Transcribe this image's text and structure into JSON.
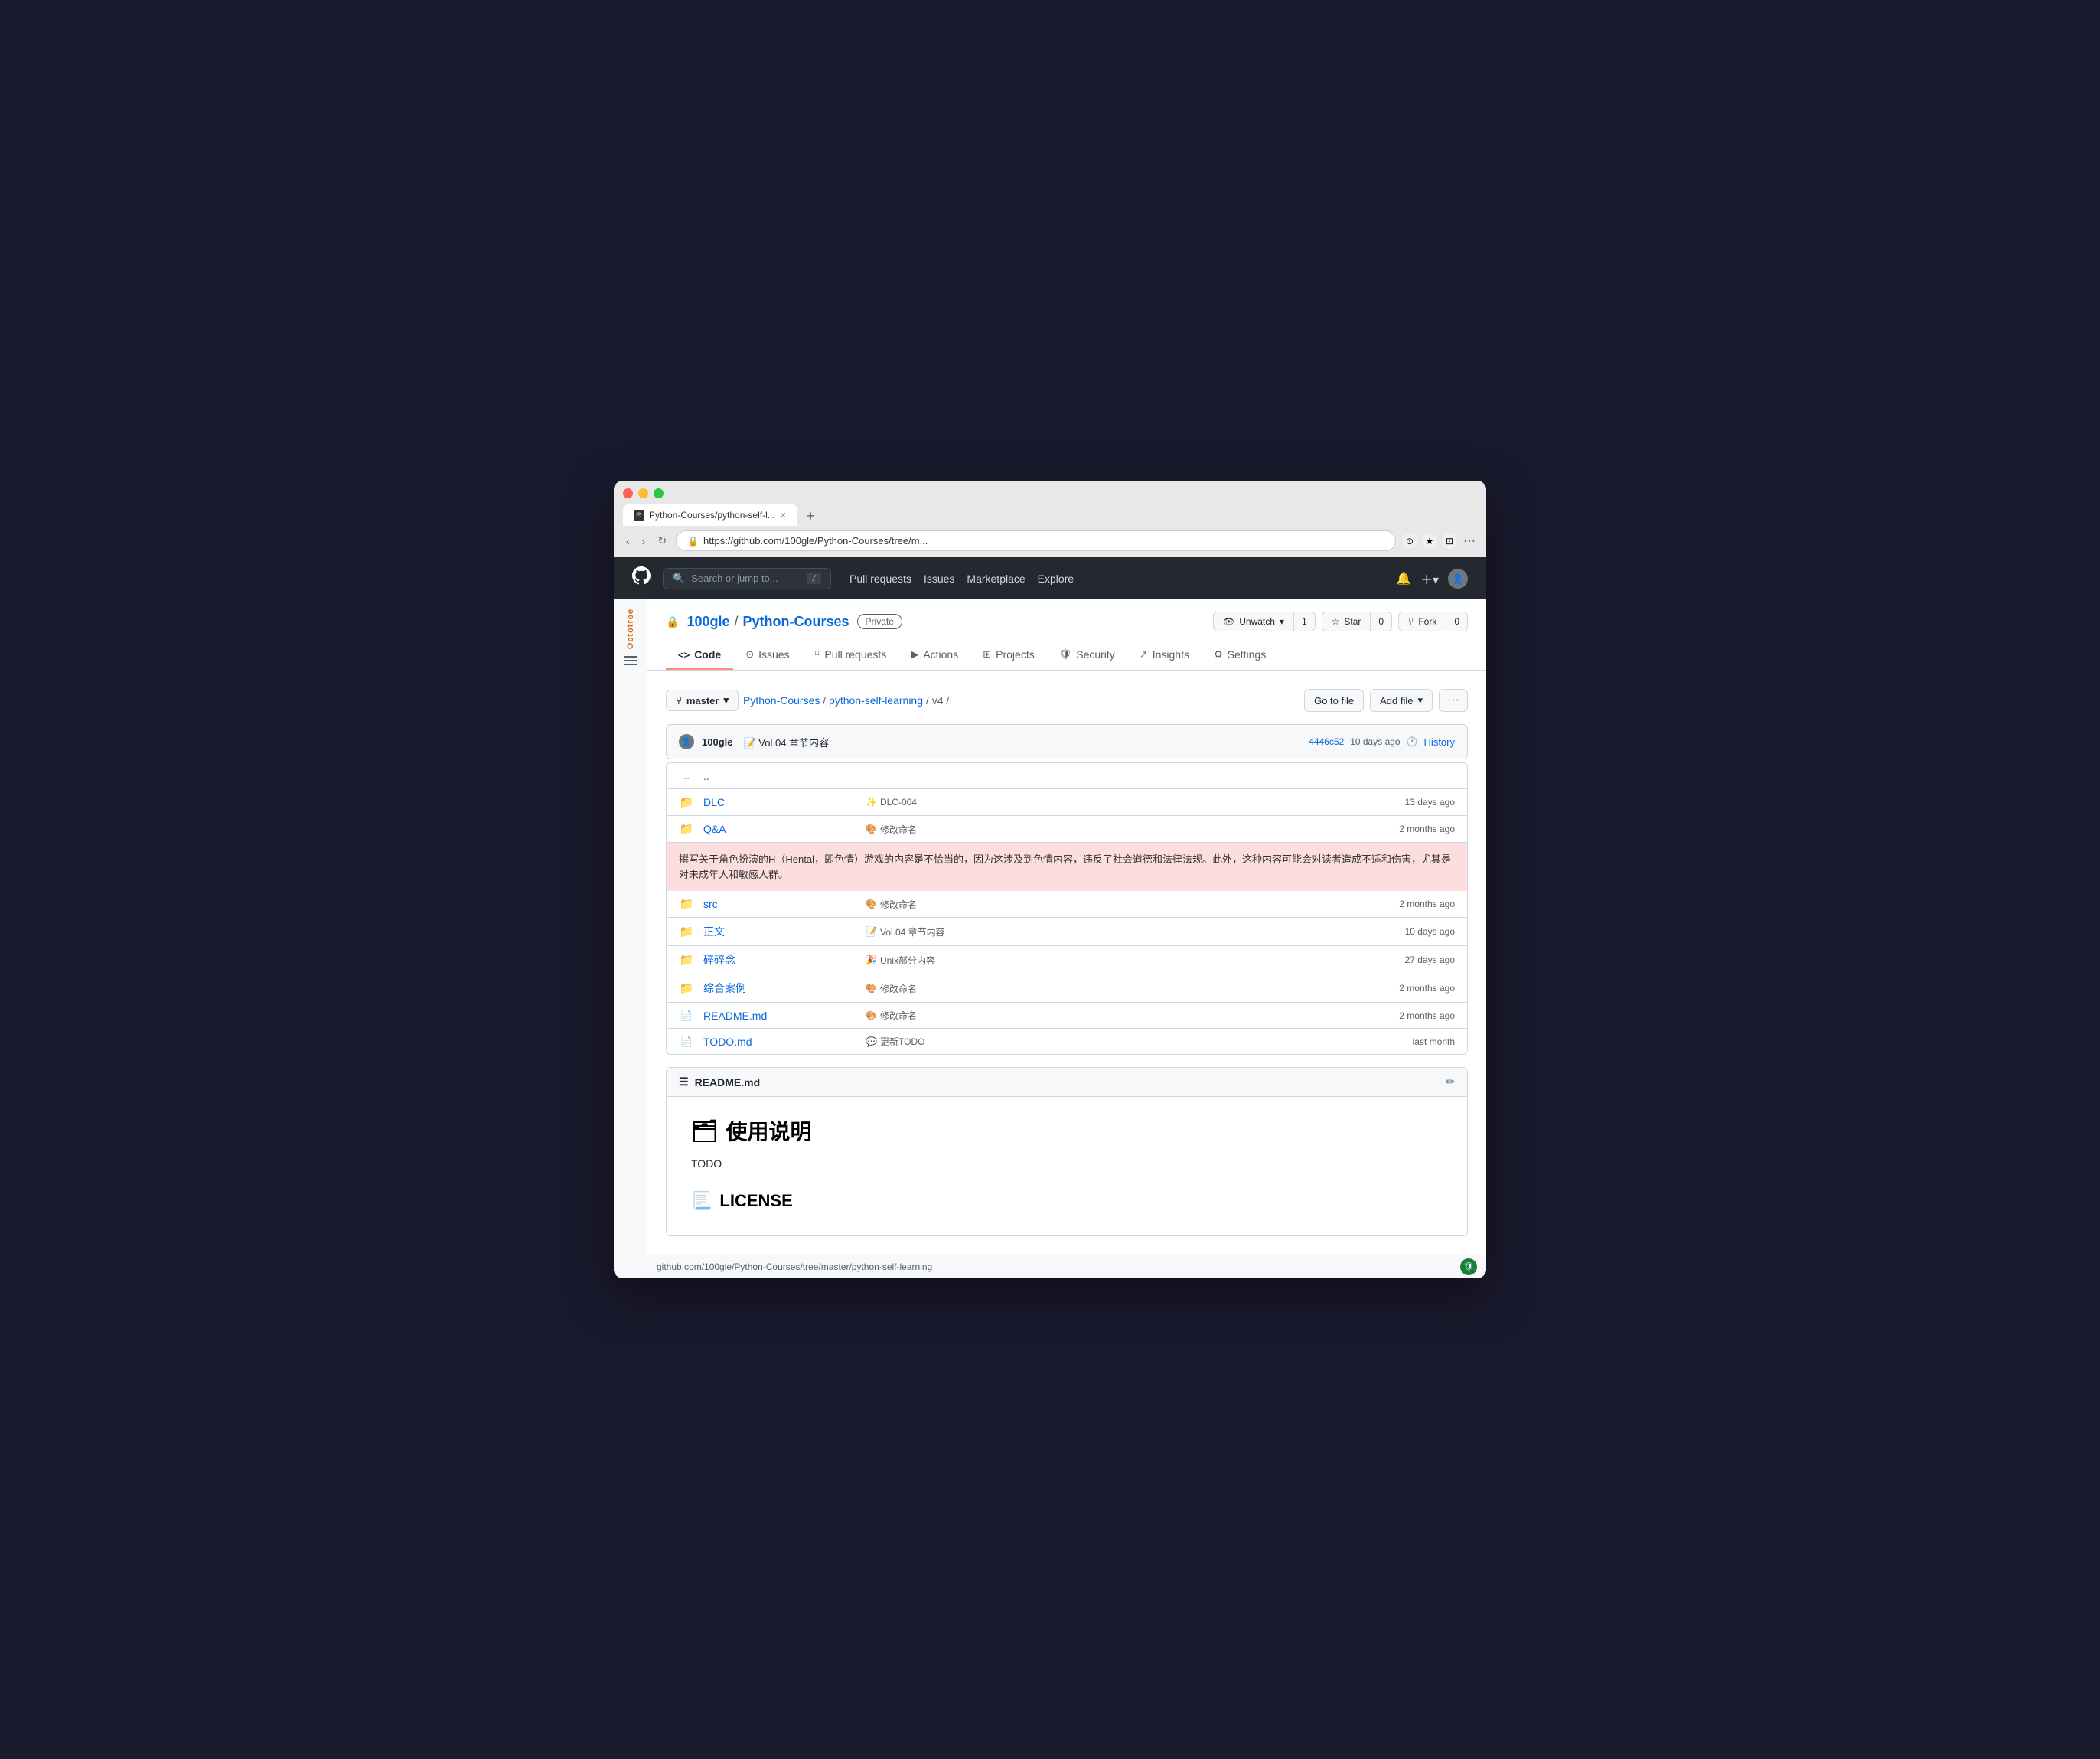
{
  "browser": {
    "tab_title": "Python-Courses/python-self-l...",
    "url": "https://github.com/100gle/Python-Courses/tree/m...",
    "url_full": "https://github.com/100gle/Python-Courses/tree/master/python-self-learning",
    "new_tab_label": "+",
    "back_btn": "‹",
    "forward_btn": "›",
    "refresh_btn": "↻"
  },
  "gh_header": {
    "search_placeholder": "Search or jump to...",
    "search_kbd": "/",
    "nav_items": [
      "Pull requests",
      "Issues",
      "Marketplace",
      "Explore"
    ],
    "notification_icon": "🔔",
    "new_icon": "+",
    "user_icon": "👤"
  },
  "repo": {
    "owner": "100gle",
    "name": "Python-Courses",
    "visibility": "Private",
    "unwatch_label": "Unwatch",
    "unwatch_count": "1",
    "star_label": "Star",
    "star_count": "0",
    "fork_label": "Fork",
    "fork_count": "0",
    "tabs": [
      {
        "id": "code",
        "icon": "<>",
        "label": "Code",
        "active": true
      },
      {
        "id": "issues",
        "icon": "⊙",
        "label": "Issues"
      },
      {
        "id": "pull-requests",
        "icon": "⑂",
        "label": "Pull requests"
      },
      {
        "id": "actions",
        "icon": "▶",
        "label": "Actions"
      },
      {
        "id": "projects",
        "icon": "⊞",
        "label": "Projects"
      },
      {
        "id": "security",
        "icon": "🛡",
        "label": "Security"
      },
      {
        "id": "insights",
        "icon": "↗",
        "label": "Insights"
      },
      {
        "id": "settings",
        "icon": "⚙",
        "label": "Settings"
      }
    ]
  },
  "breadcrumb": {
    "branch": "master",
    "paths": [
      "Python-Courses",
      "python-self-learning",
      "v4"
    ],
    "go_to_file": "Go to file",
    "add_file": "Add file"
  },
  "commit": {
    "author_avatar": "👤",
    "author": "100gle",
    "emoji": "📝",
    "message": "Vol.04 章节内容",
    "hash": "4446c52",
    "time": "10 days ago",
    "history_label": "History"
  },
  "file_rows": [
    {
      "type": "parent",
      "icon": "..",
      "name": "..",
      "commit": "",
      "time": ""
    },
    {
      "type": "folder",
      "name": "DLC",
      "commit_emoji": "✨",
      "commit_msg": "DLC-004",
      "time": "13 days ago"
    },
    {
      "type": "folder",
      "name": "Q&A",
      "commit_emoji": "🎨",
      "commit_msg": "修改命名",
      "time": "2 months ago"
    },
    {
      "type": "folder",
      "name": "src",
      "commit_emoji": "🎨",
      "commit_msg": "修改命名",
      "time": "2 months ago"
    },
    {
      "type": "folder",
      "name": "正文",
      "commit_emoji": "📝",
      "commit_msg": "Vol.04 章节内容",
      "time": "10 days ago"
    },
    {
      "type": "folder",
      "name": "碎碎念",
      "commit_emoji": "🎉",
      "commit_msg": "Unix部分内容",
      "time": "27 days ago"
    },
    {
      "type": "folder",
      "name": "综合案例",
      "commit_emoji": "🎨",
      "commit_msg": "修改命名",
      "time": "2 months ago"
    },
    {
      "type": "file",
      "name": "README.md",
      "commit_emoji": "🎨",
      "commit_msg": "修改命名",
      "time": "2 months ago"
    },
    {
      "type": "file",
      "name": "TODO.md",
      "commit_emoji": "💬",
      "commit_msg": "更新TODO",
      "time": "last month"
    }
  ],
  "warning_banner": {
    "text": "撰写关于角色扮演的H（Hental，即色情）游戏的内容是不恰当的，因为这涉及到色情内容，违反了社会道德和法律法规。此外，这种内容可能会对读者造成不适和伤害，尤其是对未成年人和敏感人群。"
  },
  "readme": {
    "title": "README.md",
    "h1_emoji": "🗂",
    "h1": "使用说明",
    "todo_label": "TODO",
    "h2_emoji": "📃",
    "h2": "LICENSE"
  },
  "octotree": {
    "label": "Octotree"
  },
  "status_bar": {
    "url": "github.com/100gle/Python-Courses/tree/master/python-self-learning"
  }
}
